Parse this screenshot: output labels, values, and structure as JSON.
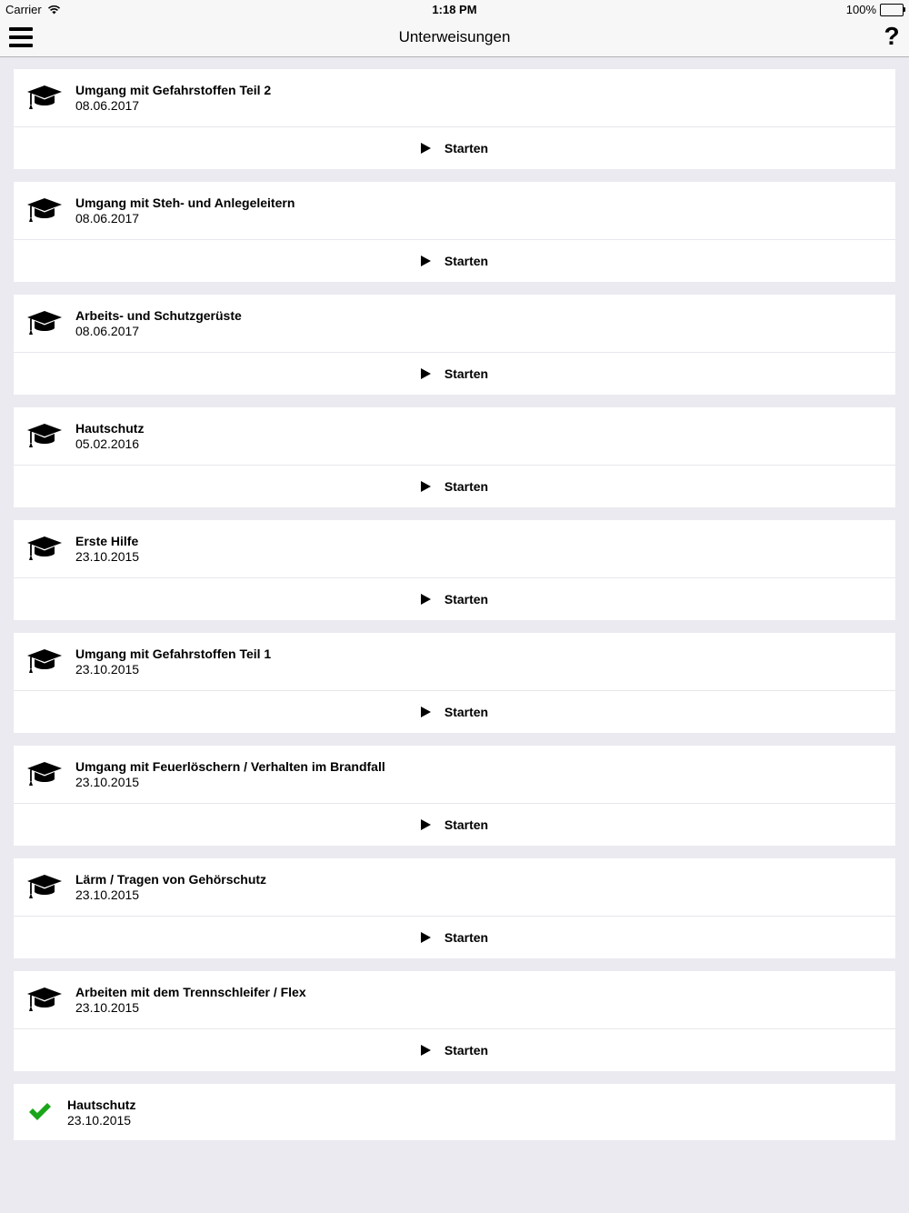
{
  "status_bar": {
    "carrier": "Carrier",
    "time": "1:18 PM",
    "battery": "100%",
    "battery_level": 1.0
  },
  "nav": {
    "title": "Unterweisungen",
    "menu_icon": "hamburger-menu-icon",
    "help_label": "?"
  },
  "trainings": [
    {
      "title": "Umgang mit Gefahrstoffen Teil 2",
      "date": "08.06.2017",
      "action": "Starten"
    },
    {
      "title": "Umgang mit Steh- und Anlegeleitern",
      "date": "08.06.2017",
      "action": "Starten"
    },
    {
      "title": "Arbeits- und Schutzgerüste",
      "date": "08.06.2017",
      "action": "Starten"
    },
    {
      "title": "Hautschutz",
      "date": "05.02.2016",
      "action": "Starten"
    },
    {
      "title": "Erste Hilfe",
      "date": "23.10.2015",
      "action": "Starten"
    },
    {
      "title": "Umgang mit Gefahrstoffen Teil 1",
      "date": "23.10.2015",
      "action": "Starten"
    },
    {
      "title": "Umgang mit Feuerlöschern / Verhalten im Brandfall",
      "date": "23.10.2015",
      "action": "Starten"
    },
    {
      "title": "Lärm / Tragen von Gehörschutz",
      "date": "23.10.2015",
      "action": "Starten"
    },
    {
      "title": "Arbeiten mit dem Trennschleifer / Flex",
      "date": "23.10.2015",
      "action": "Starten"
    }
  ],
  "completed": [
    {
      "title": "Hautschutz",
      "date": "23.10.2015"
    }
  ],
  "icons": {
    "training": "graduation-cap-icon",
    "start": "play-icon",
    "completed": "checkmark-icon"
  },
  "colors": {
    "check": "#1aa51a",
    "background": "#eaeaf0"
  }
}
